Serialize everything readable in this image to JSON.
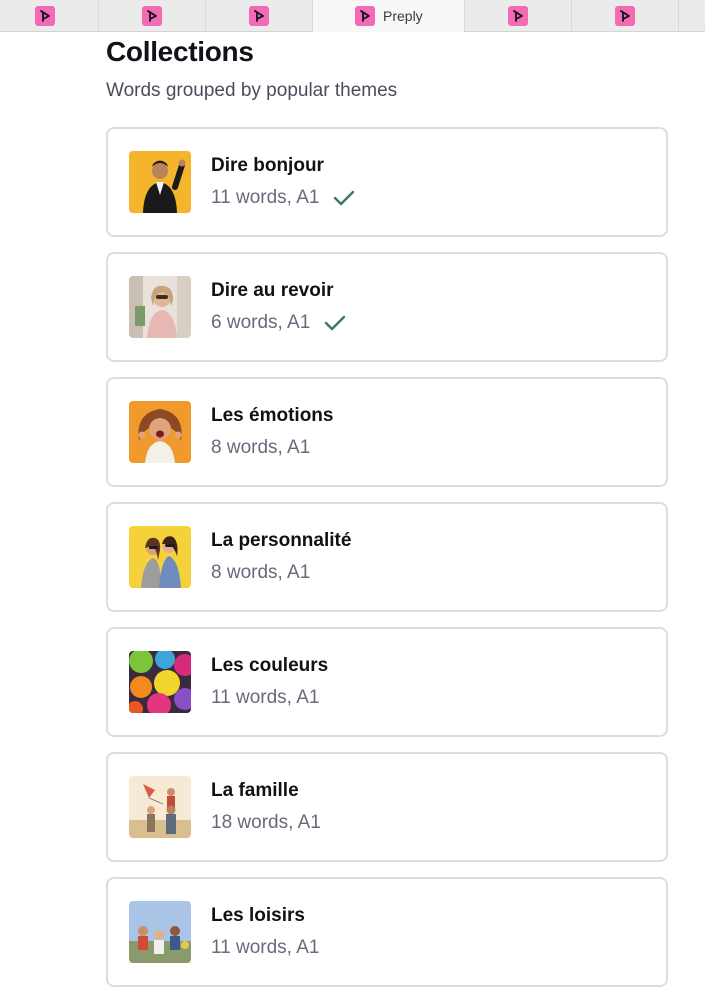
{
  "browser": {
    "tabs": [
      {
        "label": "",
        "icon": "preply-logo-icon",
        "active": false
      },
      {
        "label": "",
        "icon": "preply-logo-icon",
        "active": false
      },
      {
        "label": "",
        "icon": "preply-logo-icon",
        "active": false
      },
      {
        "label": "Preply",
        "icon": "preply-logo-icon",
        "active": true
      },
      {
        "label": "",
        "icon": "preply-logo-icon",
        "active": false
      },
      {
        "label": "",
        "icon": "preply-logo-icon",
        "active": false
      }
    ],
    "brand_color": "#f26bb4"
  },
  "header": {
    "title": "Collections",
    "subtitle": "Words grouped by popular themes"
  },
  "collections": [
    {
      "title": "Dire bonjour",
      "meta": "11 words, A1",
      "completed": true,
      "thumb": "man-waving-photo"
    },
    {
      "title": "Dire au revoir",
      "meta": "6 words, A1",
      "completed": true,
      "thumb": "woman-waving-photo"
    },
    {
      "title": "Les émotions",
      "meta": "8 words, A1",
      "completed": false,
      "thumb": "excited-woman-photo"
    },
    {
      "title": "La personnalité",
      "meta": "8 words, A1",
      "completed": false,
      "thumb": "two-friends-photo"
    },
    {
      "title": "Les couleurs",
      "meta": "11 words, A1",
      "completed": false,
      "thumb": "color-powder-photo"
    },
    {
      "title": "La famille",
      "meta": "18 words, A1",
      "completed": false,
      "thumb": "family-kite-photo"
    },
    {
      "title": "Les loisirs",
      "meta": "11 words, A1",
      "completed": false,
      "thumb": "people-outdoors-photo"
    }
  ],
  "colors": {
    "check": "#3d7a5a",
    "card_border": "#dcdce5",
    "meta_text": "#6a697c"
  }
}
